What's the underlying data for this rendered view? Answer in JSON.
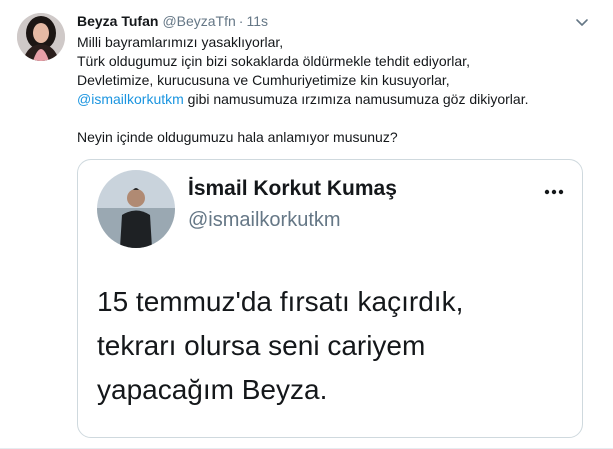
{
  "tweet": {
    "display_name": "Beyza Tufan",
    "handle": "@BeyzaTfn",
    "separator": "·",
    "time": "11s",
    "lines": [
      "Milli bayramlarımızı yasaklıyorlar,",
      "Türk oldugumuz için bizi sokaklarda öldürmekle tehdit ediyorlar,",
      "Devletimize, kurucusuna ve Cumhuriyetimize kin kusuyorlar,"
    ],
    "mention": "@ismailkorkutkm",
    "mention_rest": " gibi namusumuza ırzımıza namusumuza göz dikiyorlar.",
    "closing_line": "Neyin içinde oldugumuzu hala anlamıyor musunuz?"
  },
  "quoted": {
    "display_name": "İsmail Korkut Kumaş",
    "handle": "@ismailkorkutkm",
    "text_lines": [
      "15 temmuz'da fırsatı kaçırdık,",
      "tekrarı olursa seni cariyem",
      "yapacağım Beyza."
    ]
  },
  "icons": {
    "caret": "chevron-down-icon",
    "more": "more-horizontal-icon"
  },
  "colors": {
    "link": "#1b95e0",
    "secondary_text": "#657786",
    "border": "#cfd9de"
  }
}
